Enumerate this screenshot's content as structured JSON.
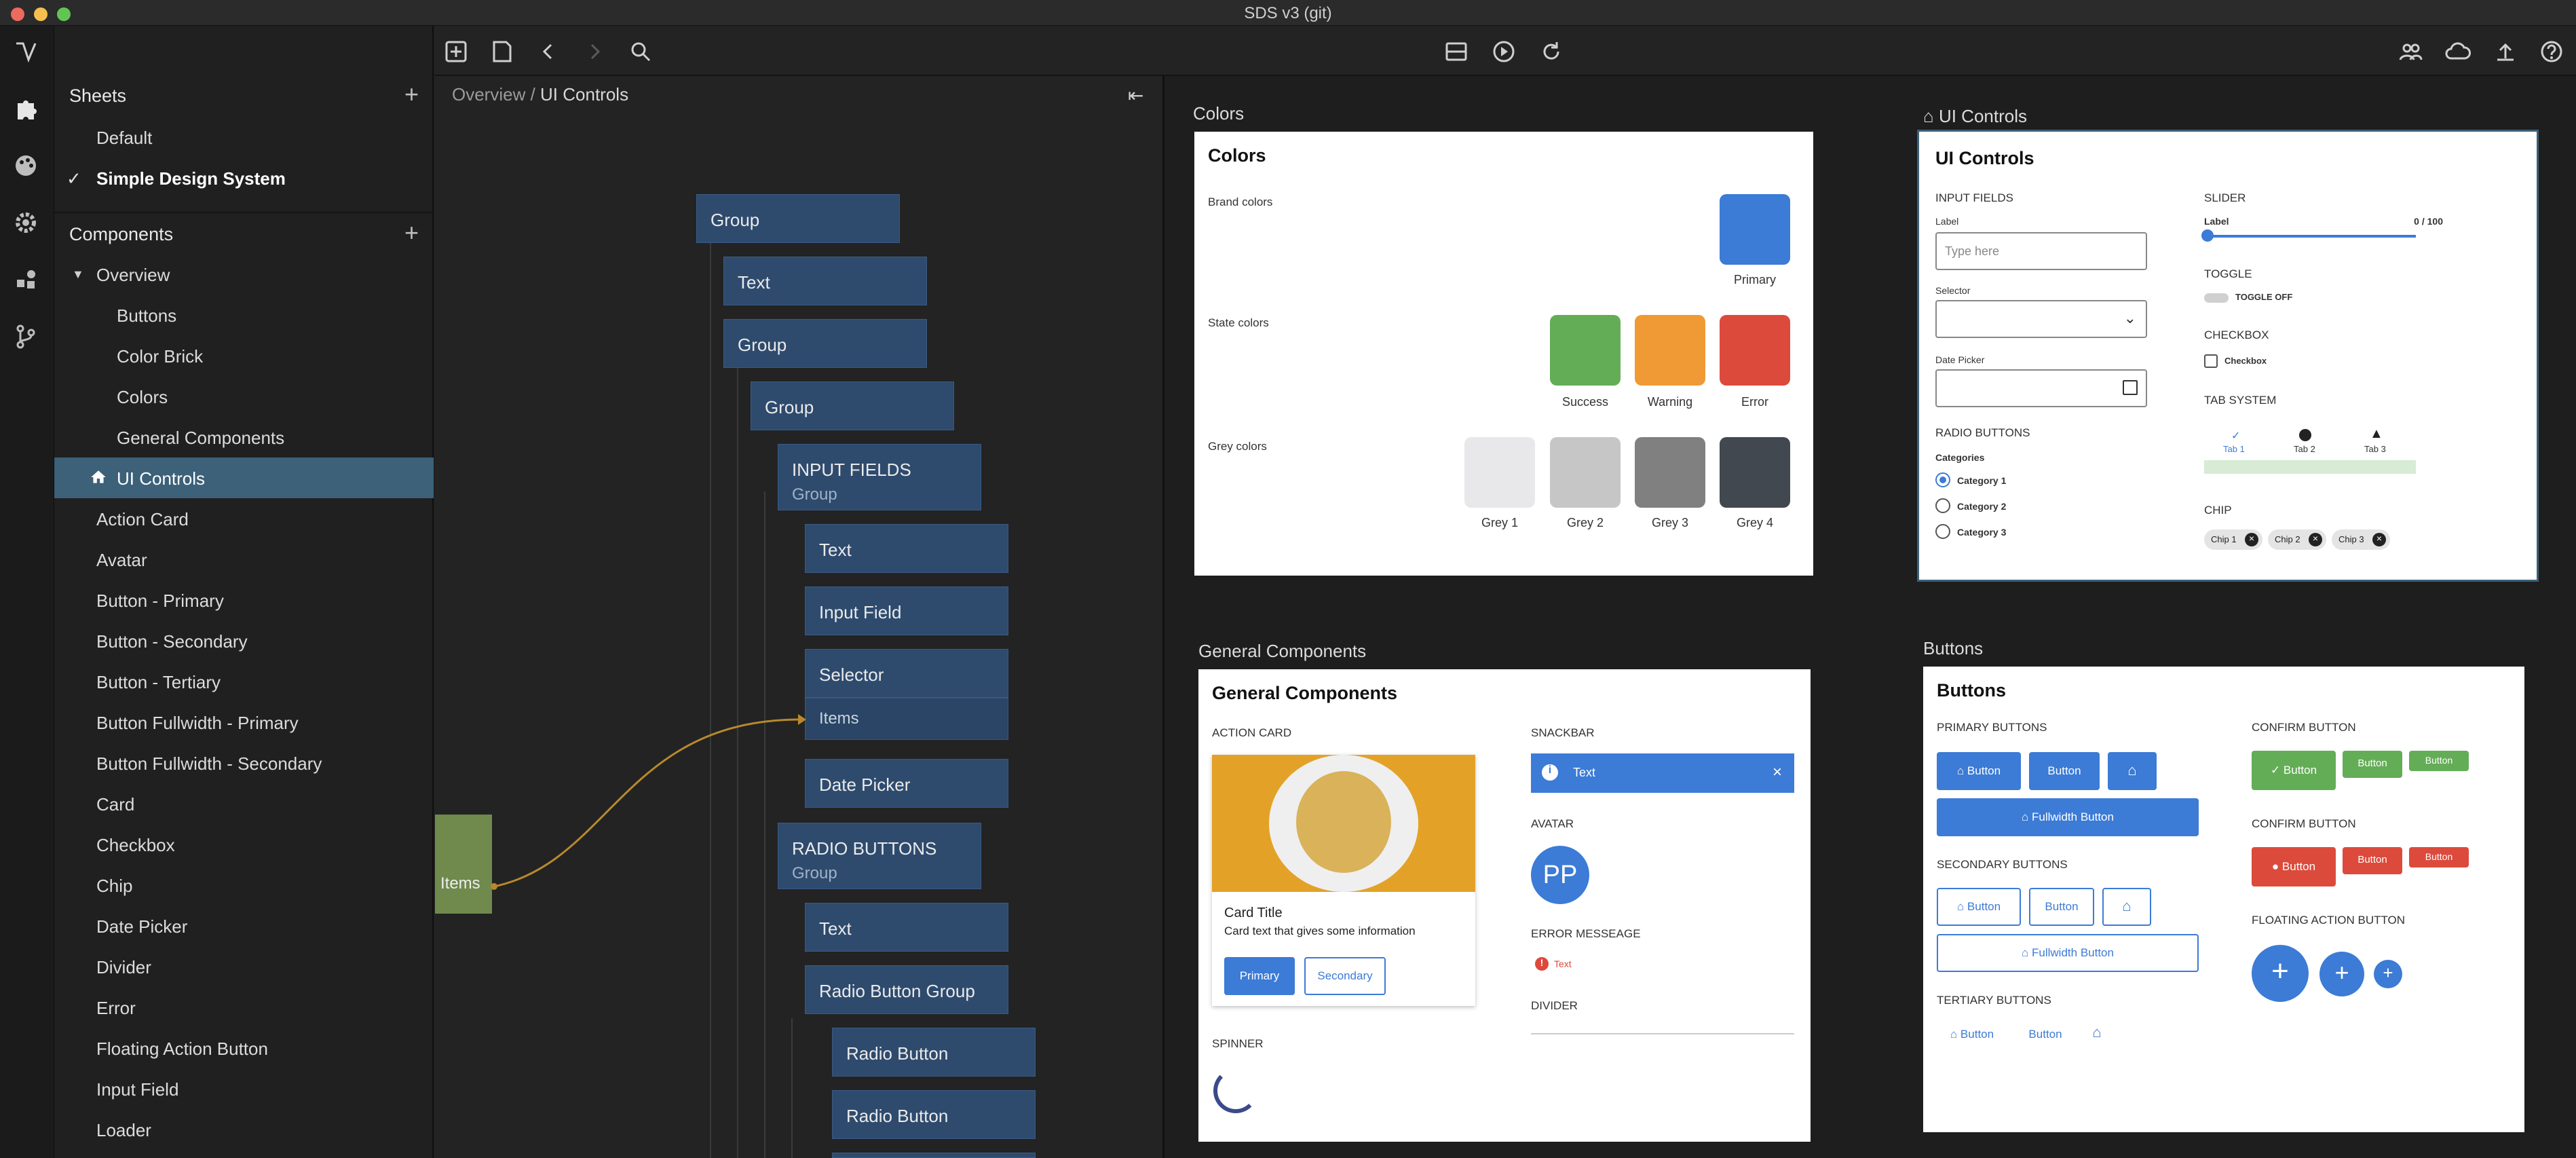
{
  "window": {
    "title": "SDS v3 (git)"
  },
  "sidebar": {
    "sheets_label": "Sheets",
    "sheets": [
      "Default",
      "Simple Design System"
    ],
    "active_sheet_check": "✓",
    "components_label": "Components",
    "overview_label": "Overview",
    "overview_children": [
      "Buttons",
      "Color Brick",
      "Colors",
      "General Components",
      "UI Controls"
    ],
    "components": [
      "Action Card",
      "Avatar",
      "Button - Primary",
      "Button - Secondary",
      "Button - Tertiary",
      "Button Fullwidth - Primary",
      "Button Fullwidth - Secondary",
      "Card",
      "Checkbox",
      "Chip",
      "Date Picker",
      "Divider",
      "Error",
      "Floating Action Button",
      "Input Field",
      "Loader"
    ]
  },
  "breadcrumb": {
    "parent": "Overview",
    "separator": " / ",
    "current": "UI Controls"
  },
  "tree": {
    "nodes": [
      "Group",
      "Text",
      "Group",
      "Group",
      "INPUT FIELDS",
      "Text",
      "Input Field",
      "Selector",
      "Date Picker",
      "RADIO BUTTONS",
      "Text",
      "Radio Button Group",
      "Radio Button",
      "Radio Button"
    ],
    "group_sub": "Group",
    "items_slot": "Items",
    "items_source": "Items"
  },
  "frames": {
    "colors": {
      "label": "Colors",
      "title": "Colors",
      "brand_label": "Brand colors",
      "brand": [
        {
          "name": "Primary",
          "color": "#3c7bd6"
        }
      ],
      "state_label": "State colors",
      "state": [
        {
          "name": "Success",
          "color": "#63ad56"
        },
        {
          "name": "Warning",
          "color": "#f09a35"
        },
        {
          "name": "Error",
          "color": "#dc4a3c"
        }
      ],
      "grey_label": "Grey colors",
      "grey": [
        {
          "name": "Grey 1",
          "color": "#e8e8ea"
        },
        {
          "name": "Grey 2",
          "color": "#c6c6c6"
        },
        {
          "name": "Grey 3",
          "color": "#808080"
        },
        {
          "name": "Grey 4",
          "color": "#414850"
        }
      ]
    },
    "ui": {
      "label": "UI Controls",
      "title": "UI Controls",
      "input_fields": "INPUT FIELDS",
      "label_label": "Label",
      "placeholder": "Type here",
      "selector_label": "Selector",
      "date_label": "Date Picker",
      "radio_heading": "RADIO BUTTONS",
      "categories": "Categories",
      "radio_options": [
        "Category 1",
        "Category 2",
        "Category 3"
      ],
      "slider_heading": "SLIDER",
      "slider_label": "Label",
      "slider_value": "0 / 100",
      "toggle_heading": "TOGGLE",
      "toggle_text": "TOGGLE OFF",
      "checkbox_heading": "CHECKBOX",
      "checkbox_text": "Checkbox",
      "tab_heading": "TAB SYSTEM",
      "tabs": [
        "Tab 1",
        "Tab 2",
        "Tab 3"
      ],
      "chip_heading": "CHIP",
      "chips": [
        "Chip 1",
        "Chip 2",
        "Chip 3"
      ]
    },
    "general": {
      "label": "General Components",
      "title": "General Components",
      "action_card": "ACTION CARD",
      "card_title": "Card Title",
      "card_text": "Card text that gives some information",
      "primary": "Primary",
      "secondary": "Secondary",
      "snackbar_heading": "SNACKBAR",
      "snackbar_text": "Text",
      "avatar_heading": "AVATAR",
      "avatar_initials": "PP",
      "error_heading": "ERROR MESSEAGE",
      "error_text": "Text",
      "divider_heading": "DIVIDER",
      "spinner_heading": "SPINNER"
    },
    "buttons": {
      "label": "Buttons",
      "title": "Buttons",
      "primary_heading": "PRIMARY BUTTONS",
      "button": "Button",
      "fullwidth": "Fullwidth Button",
      "secondary_heading": "SECONDARY BUTTONS",
      "tertiary_heading": "TERTIARY BUTTONS",
      "confirm_heading": "CONFIRM BUTTON",
      "confirm_heading2": "CONFIRM BUTTON",
      "fab_heading": "FLOATING ACTION BUTTON",
      "fab_glyph": "+"
    }
  },
  "colors": {
    "accent": "#3c7bd6",
    "active_row": "#3c6179",
    "node": "#2e4b6e",
    "items_node": "#6f8a4c"
  }
}
